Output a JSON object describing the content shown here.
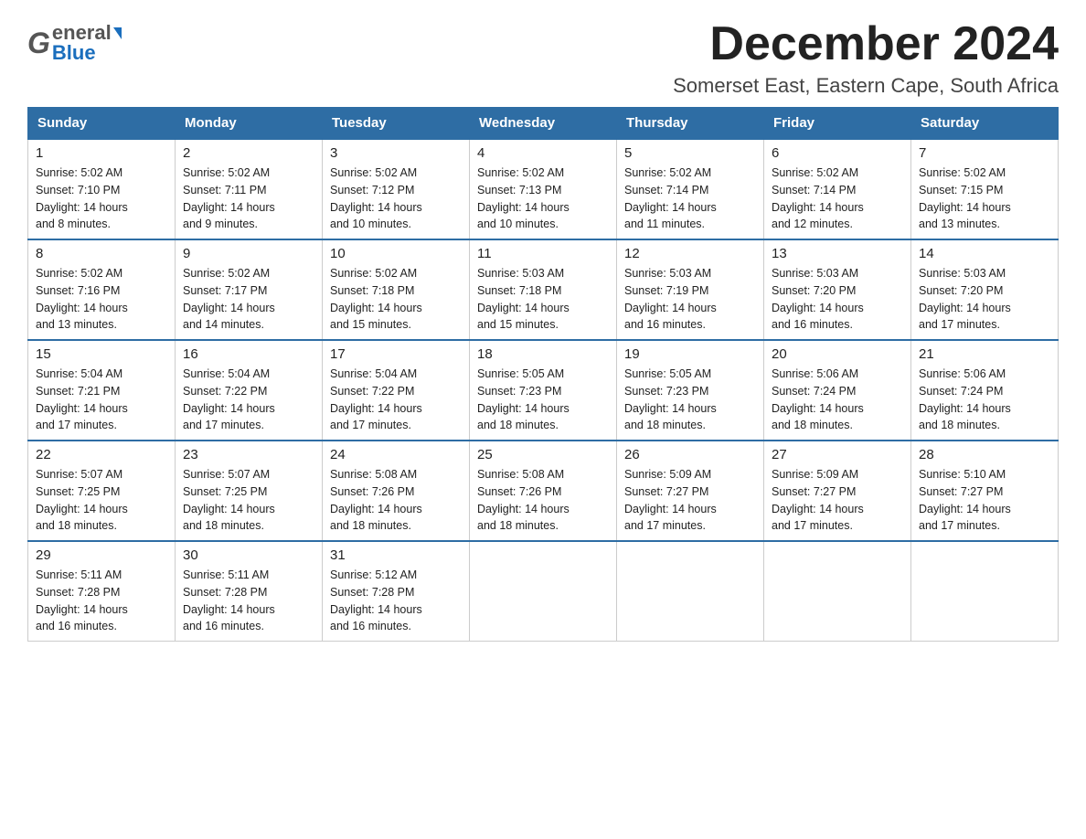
{
  "header": {
    "logo_general": "General",
    "logo_blue": "Blue",
    "month_title": "December 2024",
    "location": "Somerset East, Eastern Cape, South Africa"
  },
  "days_of_week": [
    "Sunday",
    "Monday",
    "Tuesday",
    "Wednesday",
    "Thursday",
    "Friday",
    "Saturday"
  ],
  "weeks": [
    [
      {
        "day": "1",
        "sunrise": "5:02 AM",
        "sunset": "7:10 PM",
        "daylight": "14 hours and 8 minutes."
      },
      {
        "day": "2",
        "sunrise": "5:02 AM",
        "sunset": "7:11 PM",
        "daylight": "14 hours and 9 minutes."
      },
      {
        "day": "3",
        "sunrise": "5:02 AM",
        "sunset": "7:12 PM",
        "daylight": "14 hours and 10 minutes."
      },
      {
        "day": "4",
        "sunrise": "5:02 AM",
        "sunset": "7:13 PM",
        "daylight": "14 hours and 10 minutes."
      },
      {
        "day": "5",
        "sunrise": "5:02 AM",
        "sunset": "7:14 PM",
        "daylight": "14 hours and 11 minutes."
      },
      {
        "day": "6",
        "sunrise": "5:02 AM",
        "sunset": "7:14 PM",
        "daylight": "14 hours and 12 minutes."
      },
      {
        "day": "7",
        "sunrise": "5:02 AM",
        "sunset": "7:15 PM",
        "daylight": "14 hours and 13 minutes."
      }
    ],
    [
      {
        "day": "8",
        "sunrise": "5:02 AM",
        "sunset": "7:16 PM",
        "daylight": "14 hours and 13 minutes."
      },
      {
        "day": "9",
        "sunrise": "5:02 AM",
        "sunset": "7:17 PM",
        "daylight": "14 hours and 14 minutes."
      },
      {
        "day": "10",
        "sunrise": "5:02 AM",
        "sunset": "7:18 PM",
        "daylight": "14 hours and 15 minutes."
      },
      {
        "day": "11",
        "sunrise": "5:03 AM",
        "sunset": "7:18 PM",
        "daylight": "14 hours and 15 minutes."
      },
      {
        "day": "12",
        "sunrise": "5:03 AM",
        "sunset": "7:19 PM",
        "daylight": "14 hours and 16 minutes."
      },
      {
        "day": "13",
        "sunrise": "5:03 AM",
        "sunset": "7:20 PM",
        "daylight": "14 hours and 16 minutes."
      },
      {
        "day": "14",
        "sunrise": "5:03 AM",
        "sunset": "7:20 PM",
        "daylight": "14 hours and 17 minutes."
      }
    ],
    [
      {
        "day": "15",
        "sunrise": "5:04 AM",
        "sunset": "7:21 PM",
        "daylight": "14 hours and 17 minutes."
      },
      {
        "day": "16",
        "sunrise": "5:04 AM",
        "sunset": "7:22 PM",
        "daylight": "14 hours and 17 minutes."
      },
      {
        "day": "17",
        "sunrise": "5:04 AM",
        "sunset": "7:22 PM",
        "daylight": "14 hours and 17 minutes."
      },
      {
        "day": "18",
        "sunrise": "5:05 AM",
        "sunset": "7:23 PM",
        "daylight": "14 hours and 18 minutes."
      },
      {
        "day": "19",
        "sunrise": "5:05 AM",
        "sunset": "7:23 PM",
        "daylight": "14 hours and 18 minutes."
      },
      {
        "day": "20",
        "sunrise": "5:06 AM",
        "sunset": "7:24 PM",
        "daylight": "14 hours and 18 minutes."
      },
      {
        "day": "21",
        "sunrise": "5:06 AM",
        "sunset": "7:24 PM",
        "daylight": "14 hours and 18 minutes."
      }
    ],
    [
      {
        "day": "22",
        "sunrise": "5:07 AM",
        "sunset": "7:25 PM",
        "daylight": "14 hours and 18 minutes."
      },
      {
        "day": "23",
        "sunrise": "5:07 AM",
        "sunset": "7:25 PM",
        "daylight": "14 hours and 18 minutes."
      },
      {
        "day": "24",
        "sunrise": "5:08 AM",
        "sunset": "7:26 PM",
        "daylight": "14 hours and 18 minutes."
      },
      {
        "day": "25",
        "sunrise": "5:08 AM",
        "sunset": "7:26 PM",
        "daylight": "14 hours and 18 minutes."
      },
      {
        "day": "26",
        "sunrise": "5:09 AM",
        "sunset": "7:27 PM",
        "daylight": "14 hours and 17 minutes."
      },
      {
        "day": "27",
        "sunrise": "5:09 AM",
        "sunset": "7:27 PM",
        "daylight": "14 hours and 17 minutes."
      },
      {
        "day": "28",
        "sunrise": "5:10 AM",
        "sunset": "7:27 PM",
        "daylight": "14 hours and 17 minutes."
      }
    ],
    [
      {
        "day": "29",
        "sunrise": "5:11 AM",
        "sunset": "7:28 PM",
        "daylight": "14 hours and 16 minutes."
      },
      {
        "day": "30",
        "sunrise": "5:11 AM",
        "sunset": "7:28 PM",
        "daylight": "14 hours and 16 minutes."
      },
      {
        "day": "31",
        "sunrise": "5:12 AM",
        "sunset": "7:28 PM",
        "daylight": "14 hours and 16 minutes."
      },
      null,
      null,
      null,
      null
    ]
  ],
  "labels": {
    "sunrise": "Sunrise:",
    "sunset": "Sunset:",
    "daylight": "Daylight: 14 hours"
  }
}
